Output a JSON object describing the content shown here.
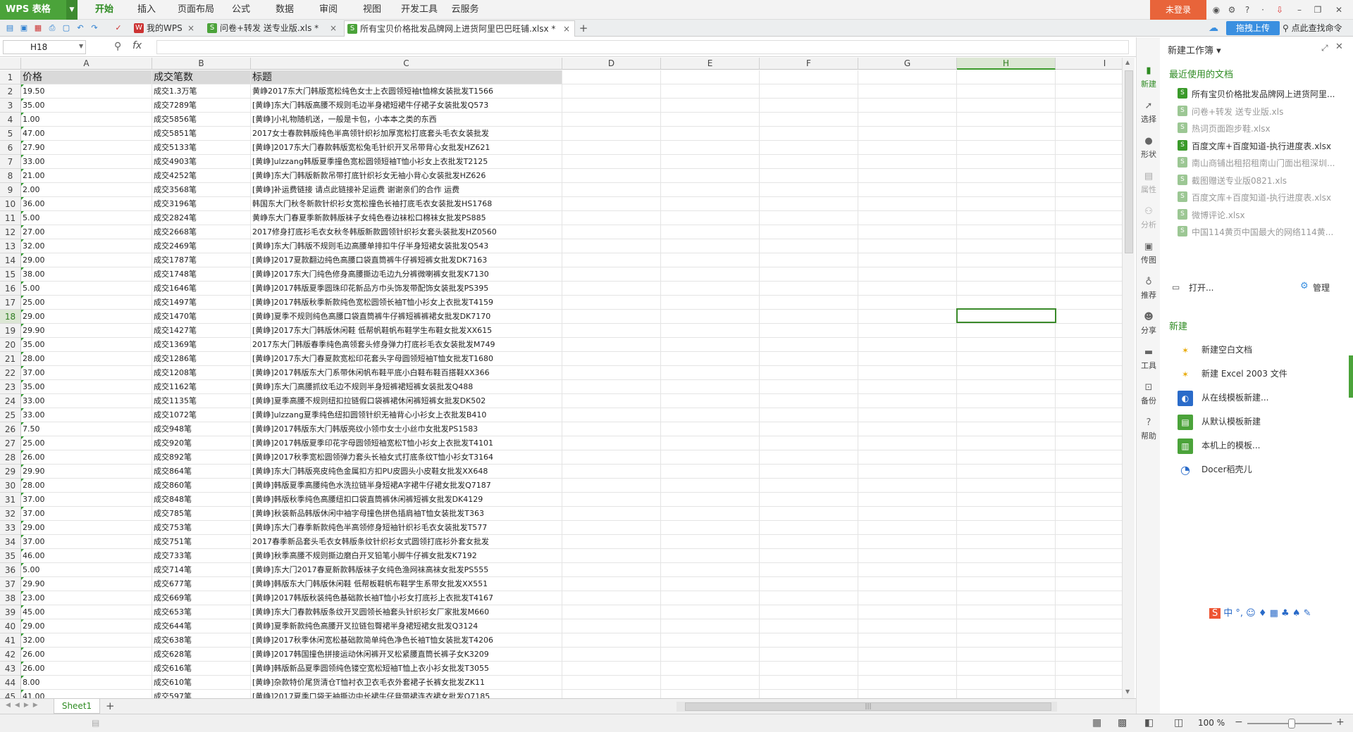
{
  "app": {
    "name": "WPS 表格",
    "login": "未登录",
    "upload": "拖拽上传",
    "find_cmd": "点此查找命令"
  },
  "menu": [
    "开始",
    "插入",
    "页面布局",
    "公式",
    "数据",
    "审阅",
    "视图",
    "开发工具",
    "云服务"
  ],
  "tabs": [
    {
      "label": "我的WPS",
      "close": "×"
    },
    {
      "label": "问卷+转发 送专业版.xls *",
      "close": "×"
    },
    {
      "label": "所有宝贝价格批发品牌网上进货阿里巴巴旺铺.xlsx *",
      "close": "×"
    }
  ],
  "formula": {
    "cell_ref": "H18",
    "fx": "fx",
    "value": ""
  },
  "columns": [
    "A",
    "B",
    "C",
    "D",
    "E",
    "F",
    "G",
    "H",
    "I"
  ],
  "selected_column": "H",
  "selected_row": "18",
  "header_row": {
    "a": "价格",
    "b": "成交笔数",
    "c": "标题"
  },
  "rows": [
    [
      "2",
      "19.50",
      "成交1.3万笔",
      "黄峥2017东大门韩版宽松纯色女士上衣圆领短袖t恤棉女装批发T1566"
    ],
    [
      "3",
      "35.00",
      "成交7289笔",
      "[黄峥]东大门韩版高腰不规则毛边半身裙短裙牛仔裙子女装批发Q573"
    ],
    [
      "4",
      "1.00",
      "成交5856笔",
      "[黄峥]小礼物随机送，一般是卡包，小本本之类的东西"
    ],
    [
      "5",
      "47.00",
      "成交5851笔",
      "2017女士春款韩版纯色半高领针织衫加厚宽松打底套头毛衣女装批发"
    ],
    [
      "6",
      "27.90",
      "成交5133笔",
      "[黄峥]2017东大门春款韩版宽松兔毛针织开叉吊带背心女批发HZ621"
    ],
    [
      "7",
      "33.00",
      "成交4903笔",
      "[黄峥]ulzzang韩版夏季撞色宽松圆领短袖T恤小衫女上衣批发T2125"
    ],
    [
      "8",
      "21.00",
      "成交4252笔",
      "[黄峥]东大门韩版新款吊带打底针织衫女无袖小背心女装批发HZ626"
    ],
    [
      "9",
      "2.00",
      "成交3568笔",
      "[黄峥]补运费链接 请点此链接补足运费 谢谢亲们的合作 运费"
    ],
    [
      "10",
      "36.00",
      "成交3196笔",
      "韩国东大门秋冬新款针织衫女宽松撞色长袖打底毛衣女装批发HS1768"
    ],
    [
      "11",
      "5.00",
      "成交2824笔",
      "黄峥东大门春夏季新款韩版袜子女纯色卷边袜松口棉袜女批发PS885"
    ],
    [
      "12",
      "27.00",
      "成交2668笔",
      "2017修身打底衫毛衣女秋冬韩版新款圆领针织衫女套头装批发HZ0560"
    ],
    [
      "13",
      "32.00",
      "成交2469笔",
      "[黄峥]东大门韩版不规则毛边高腰单排扣牛仔半身短裙女装批发Q543"
    ],
    [
      "14",
      "29.00",
      "成交1787笔",
      "[黄峥]2017夏款翻边纯色高腰口袋直筒裤牛仔裤短裤女批发DK7163"
    ],
    [
      "15",
      "38.00",
      "成交1748笔",
      "[黄峥]2017东大门纯色修身高腰撕边毛边九分裤微喇裤女批发K7130"
    ],
    [
      "16",
      "5.00",
      "成交1646笔",
      "[黄峥]2017韩版夏季圆珠印花新品方巾头饰发带配饰女装批发PS395"
    ],
    [
      "17",
      "25.00",
      "成交1497笔",
      "[黄峥]2017韩版秋季新款纯色宽松圆领长袖T恤小衫女上衣批发T4159"
    ],
    [
      "18",
      "29.00",
      "成交1470笔",
      "[黄峥]夏季不规则纯色高腰口袋直筒裤牛仔裤短裤裤裙女批发DK7170"
    ],
    [
      "19",
      "29.90",
      "成交1427笔",
      "[黄峥]2017东大门韩版休闲鞋 低帮帆鞋帆布鞋学生布鞋女批发XX615"
    ],
    [
      "20",
      "35.00",
      "成交1369笔",
      "2017东大门韩版春季纯色高领套头修身弹力打底衫毛衣女装批发M749"
    ],
    [
      "21",
      "28.00",
      "成交1286笔",
      "[黄峥]2017东大门春夏款宽松印花套头字母圆领短袖T恤女批发T1680"
    ],
    [
      "22",
      "37.00",
      "成交1208笔",
      "[黄峥]2017韩版东大门系带休闲帆布鞋平底小白鞋布鞋百搭鞋XX366"
    ],
    [
      "23",
      "35.00",
      "成交1162笔",
      "[黄峥]东大门高腰抓纹毛边不规则半身短裤裙短裤女装批发Q488"
    ],
    [
      "24",
      "33.00",
      "成交1135笔",
      "[黄峥]夏季高腰不规则纽扣拉链假口袋裤裙休闲裤短裤女批发DK502"
    ],
    [
      "25",
      "33.00",
      "成交1072笔",
      "[黄峥]ulzzang夏季纯色纽扣圆领针织无袖背心小衫女上衣批发B410"
    ],
    [
      "26",
      "7.50",
      "成交948笔",
      "[黄峥]2017韩版东大门韩版亮纹小领巾女士小丝巾女批发PS1583"
    ],
    [
      "27",
      "25.00",
      "成交920笔",
      "[黄峥]2017韩版夏季印花字母圆领短袖宽松T恤小衫女上衣批发T4101"
    ],
    [
      "28",
      "26.00",
      "成交892笔",
      "[黄峥]2017秋季宽松圆领弹力套头长袖女式打底条纹T恤小衫女T3164"
    ],
    [
      "29",
      "29.90",
      "成交864笔",
      "[黄峥]东大门韩版亮皮纯色金属扣方扣PU皮圆头小皮鞋女批发XX648"
    ],
    [
      "30",
      "28.00",
      "成交860笔",
      "[黄峥]韩版夏季高腰纯色水洗拉链半身短裙A字裙牛仔裙女批发Q7187"
    ],
    [
      "31",
      "37.00",
      "成交848笔",
      "[黄峥]韩版秋季纯色高腰纽扣口袋直筒裤休闲裤短裤女批发DK4129"
    ],
    [
      "32",
      "37.00",
      "成交785笔",
      "[黄峥]秋装新品韩版休闲中袖字母撞色拼色插肩袖T恤女装批发T363"
    ],
    [
      "33",
      "29.00",
      "成交753笔",
      "[黄峥]东大门春季新款纯色半高领修身短袖针织衫毛衣女装批发T577"
    ],
    [
      "34",
      "37.00",
      "成交751笔",
      "2017春季新品套头毛衣女韩版条纹针织衫女式圆领打底衫外套女批发"
    ],
    [
      "35",
      "46.00",
      "成交733笔",
      "[黄峥]秋季高腰不规则撕边磨白开叉铅笔小脚牛仔裤女批发K7192"
    ],
    [
      "36",
      "5.00",
      "成交714笔",
      "[黄峥]东大门2017春夏新款韩版袜子女纯色渔网袜高袜女批发PS555"
    ],
    [
      "37",
      "29.90",
      "成交677笔",
      "[黄峥]韩版东大门韩版休闲鞋 低帮板鞋帆布鞋学生系带女批发XX551"
    ],
    [
      "38",
      "23.00",
      "成交669笔",
      "[黄峥]2017韩版秋装纯色基础款长袖T恤小衫女打底衫上衣批发T4167"
    ],
    [
      "39",
      "45.00",
      "成交653笔",
      "[黄峥]东大门春款韩版条纹开叉圆领长袖套头针织衫女厂家批发M660"
    ],
    [
      "40",
      "29.00",
      "成交644笔",
      "[黄峥]夏季新款纯色高腰开叉拉链包臀裙半身裙短裙女批发Q3124"
    ],
    [
      "41",
      "32.00",
      "成交638笔",
      "[黄峥]2017秋季休闲宽松基础款简单纯色净色长袖T恤女装批发T4206"
    ],
    [
      "42",
      "26.00",
      "成交628笔",
      "[黄峥]2017韩国撞色拼接运动休闲裤开叉松紧腰直筒长裤子女K3209"
    ],
    [
      "43",
      "26.00",
      "成交616笔",
      "[黄峥]韩版新品夏季圆领纯色镂空宽松短袖T恤上衣小衫女批发T3055"
    ],
    [
      "44",
      "8.00",
      "成交610笔",
      "[黄峥]杂款特价尾货清仓T恤衬衣卫衣毛衣外套裙子长裤女批发ZK11"
    ],
    [
      "45",
      "41.00",
      "成交597笔",
      "[黄峥]2017夏季口袋无袖撕边中长裙牛仔背带裙连衣裙女批发Q7185"
    ]
  ],
  "sheet": {
    "name": "Sheet1",
    "add": "+"
  },
  "status": {
    "zoom": "100 %"
  },
  "side_strip": [
    "新建",
    "选择",
    "形状",
    "属性",
    "分析",
    "传图",
    "推荐",
    "分享",
    "工具",
    "备份",
    "帮助"
  ],
  "pane": {
    "title": "新建工作簿 ▾",
    "recent_title": "最近使用的文档",
    "recent": [
      {
        "name": "所有宝贝价格批发品牌网上进货阿里...",
        "dim": false
      },
      {
        "name": "问卷+转发 送专业版.xls",
        "dim": true
      },
      {
        "name": "热词页面跑步鞋.xlsx",
        "dim": true
      },
      {
        "name": "百度文库+百度知道-执行进度表.xlsx",
        "dim": false
      },
      {
        "name": "南山商铺出租招租南山门面出租深圳...",
        "dim": true
      },
      {
        "name": "截图赠送专业版0821.xls",
        "dim": true
      },
      {
        "name": "百度文库+百度知道-执行进度表.xlsx",
        "dim": true
      },
      {
        "name": "微博评论.xlsx",
        "dim": true
      },
      {
        "name": "中国114黄页中国最大的网络114黄...",
        "dim": true
      }
    ],
    "open": "打开...",
    "manage": "管理",
    "new_title": "新建",
    "new_items": [
      "新建空白文档",
      "新建 Excel 2003 文件",
      "从在线模板新建...",
      "从默认模板新建",
      "本机上的模板...",
      "Docer稻壳儿"
    ]
  },
  "ime": "中 °, ☺ ♦ ▦ ♣ ♠ ✎"
}
